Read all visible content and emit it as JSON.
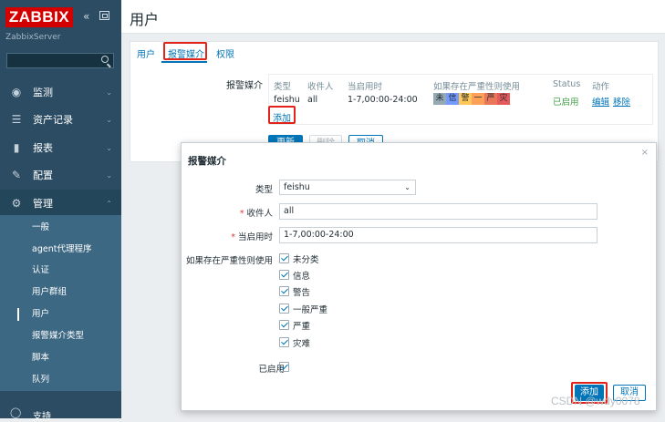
{
  "sidebar": {
    "logo": "ZABBIX",
    "collapse_icon": "«",
    "server_name": "ZabbixServer",
    "menu": [
      {
        "label": "监测",
        "icon": "eye-icon",
        "glyph": "◉"
      },
      {
        "label": "资产记录",
        "icon": "list-icon",
        "glyph": "☰"
      },
      {
        "label": "报表",
        "icon": "bar-chart-icon",
        "glyph": "▮"
      },
      {
        "label": "配置",
        "icon": "wrench-icon",
        "glyph": "🔧"
      },
      {
        "label": "管理",
        "icon": "gear-icon",
        "glyph": "⚙"
      }
    ],
    "admin_submenu": [
      "一般",
      "agent代理程序",
      "认证",
      "用户群组",
      "用户",
      "报警媒介类型",
      "脚本",
      "队列"
    ],
    "selected_submenu": "用户",
    "bottom_item": "支持"
  },
  "header": {
    "title": "用户"
  },
  "tabs": [
    "用户",
    "报警媒介",
    "权限"
  ],
  "active_tab": "报警媒介",
  "media": {
    "label": "报警媒介",
    "columns": [
      "类型",
      "收件人",
      "当启用时",
      "如果存在严重性则使用",
      "Status",
      "动作"
    ],
    "row": {
      "type": "feishu",
      "send_to": "all",
      "when_active": "1-7,00:00-24:00",
      "severities": [
        {
          "abbr": "未",
          "color": "#97aab3"
        },
        {
          "abbr": "信",
          "color": "#7499ff"
        },
        {
          "abbr": "警",
          "color": "#ffc859"
        },
        {
          "abbr": "一",
          "color": "#ffa059"
        },
        {
          "abbr": "严",
          "color": "#e97659"
        },
        {
          "abbr": "灾",
          "color": "#e45959"
        }
      ],
      "status": "已启用",
      "action_edit": "编辑",
      "action_remove": "移除"
    },
    "add_link": "添加"
  },
  "under_buttons": {
    "update": "更新",
    "delete": "删除",
    "cancel": "取消"
  },
  "dialog": {
    "title": "报警媒介",
    "type_label": "类型",
    "type_value": "feishu",
    "send_to_label": "收件人",
    "send_to_value": "all",
    "when_active_label": "当启用时",
    "when_active_value": "1-7,00:00-24:00",
    "severity_label": "如果存在严重性则使用",
    "severities": [
      "未分类",
      "信息",
      "警告",
      "一般严重",
      "严重",
      "灾难"
    ],
    "enabled_label": "已启用",
    "add_button": "添加",
    "cancel_button": "取消",
    "close_icon": "×"
  },
  "watermark": "CSDN @wdy0078"
}
